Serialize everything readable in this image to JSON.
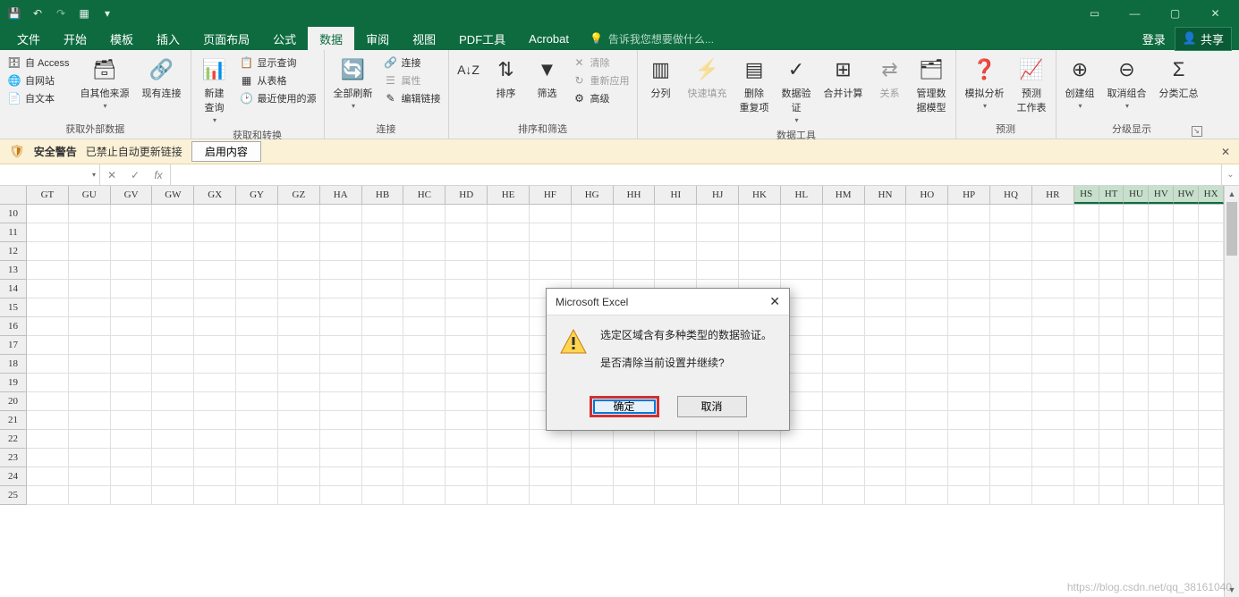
{
  "titlebar": {
    "qat": [
      "save",
      "undo",
      "redo",
      "touch-mode",
      "customize"
    ]
  },
  "tabs": {
    "items": [
      "文件",
      "开始",
      "模板",
      "插入",
      "页面布局",
      "公式",
      "数据",
      "审阅",
      "视图",
      "PDF工具",
      "Acrobat"
    ],
    "active_index": 6,
    "tell_me": "告诉我您想要做什么...",
    "login": "登录",
    "share": "共享"
  },
  "ribbon": {
    "group1": {
      "access": "自 Access",
      "web": "自网站",
      "text": "自文本",
      "other": "自其他来源",
      "existing": "现有连接",
      "label": "获取外部数据"
    },
    "group2": {
      "newquery": "新建\n查询",
      "show": "显示查询",
      "fromtable": "从表格",
      "recent": "最近使用的源",
      "label": "获取和转换"
    },
    "group3": {
      "refresh": "全部刷新",
      "conn": "连接",
      "prop": "属性",
      "edit": "编辑链接",
      "label": "连接"
    },
    "group4": {
      "sort": "排序",
      "filter": "筛选",
      "clear": "清除",
      "reapply": "重新应用",
      "adv": "高级",
      "label": "排序和筛选"
    },
    "group5": {
      "t2c": "分列",
      "flash": "快速填充",
      "dedup": "删除\n重复项",
      "valid": "数据验\n证",
      "consol": "合并计算",
      "rel": "关系",
      "model": "管理数\n据模型",
      "label": "数据工具"
    },
    "group6": {
      "whatif": "模拟分析",
      "forecast": "预测\n工作表",
      "label": "预测"
    },
    "group7": {
      "group": "创建组",
      "ungroup": "取消组合",
      "subtotal": "分类汇总",
      "label": "分级显示"
    }
  },
  "security": {
    "title": "安全警告",
    "msg": "已禁止自动更新链接",
    "enable": "启用内容"
  },
  "formula": {
    "namebox": "",
    "fx": "fx"
  },
  "columns": [
    "GT",
    "GU",
    "GV",
    "GW",
    "GX",
    "GY",
    "GZ",
    "HA",
    "HB",
    "HC",
    "HD",
    "HE",
    "HF",
    "HG",
    "HH",
    "HI",
    "HJ",
    "HK",
    "HL",
    "HM",
    "HN",
    "HO",
    "HP",
    "HQ",
    "HR"
  ],
  "columns_narrow": [
    "HS",
    "HT",
    "HU",
    "HV",
    "HW",
    "HX"
  ],
  "rows": [
    "10",
    "11",
    "12",
    "13",
    "14",
    "15",
    "16",
    "17",
    "18",
    "19",
    "20",
    "21",
    "22",
    "23",
    "24",
    "25"
  ],
  "dialog": {
    "title": "Microsoft Excel",
    "line1": "选定区域含有多种类型的数据验证。",
    "line2": "是否清除当前设置并继续?",
    "ok": "确定",
    "cancel": "取消"
  },
  "watermark": "https://blog.csdn.net/qq_38161040"
}
